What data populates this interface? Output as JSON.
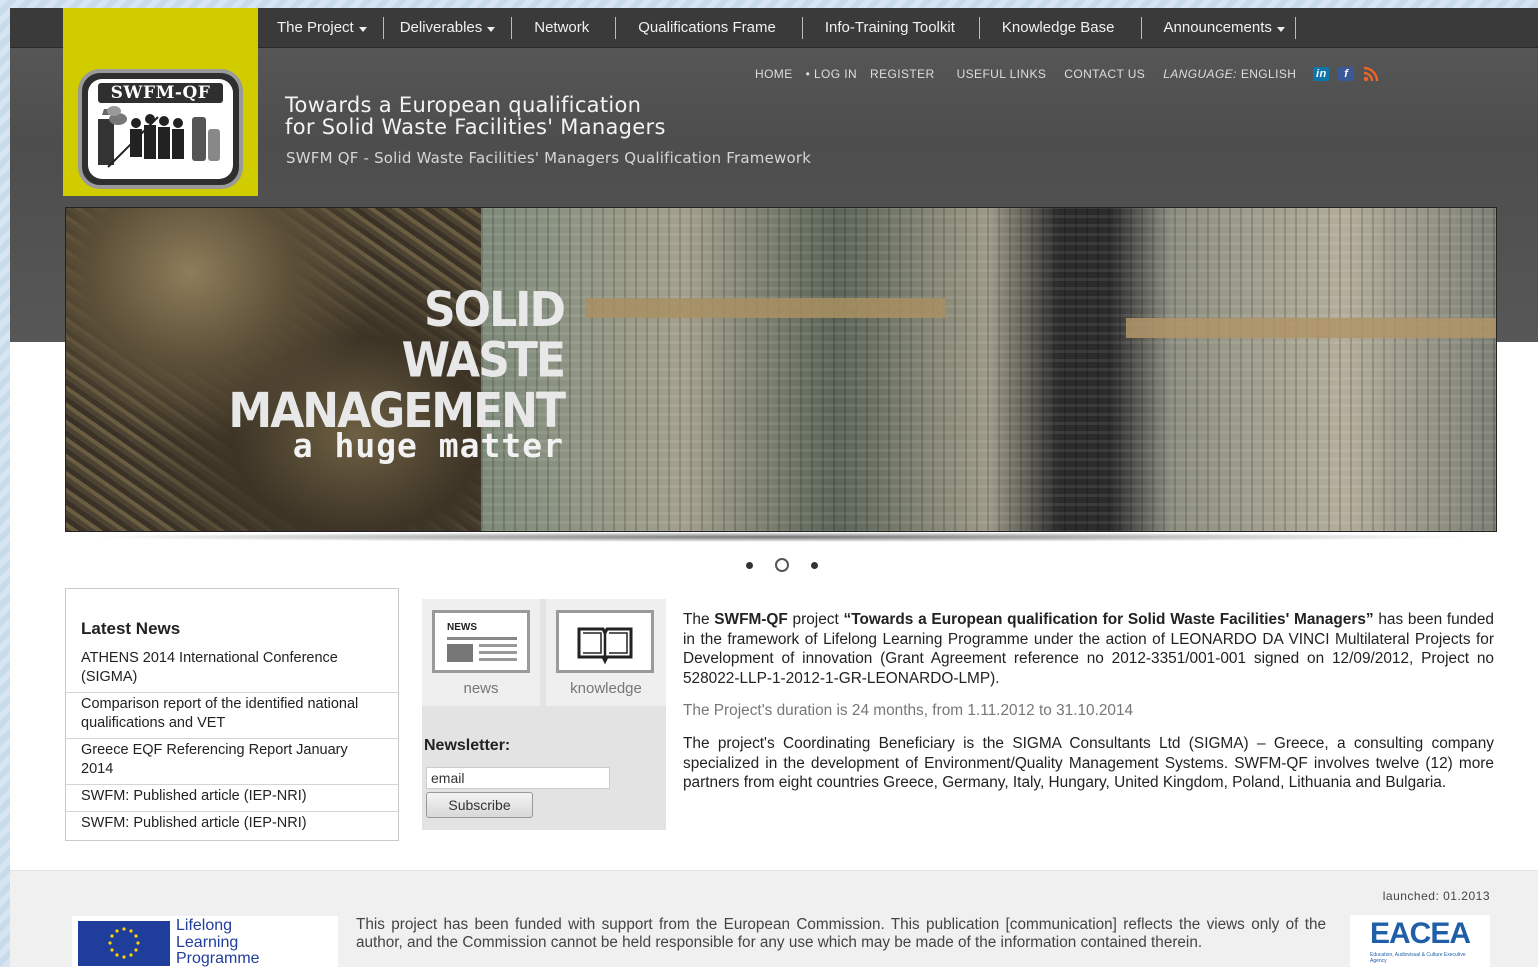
{
  "nav": {
    "items": [
      {
        "label": "The Project",
        "dropdown": true
      },
      {
        "label": "Deliverables",
        "dropdown": true
      },
      {
        "label": "Network",
        "dropdown": false
      },
      {
        "label": "Qualifications Frame",
        "dropdown": false
      },
      {
        "label": "Info-Training Toolkit",
        "dropdown": false
      },
      {
        "label": "Knowledge Base",
        "dropdown": false
      },
      {
        "label": "Announcements",
        "dropdown": true
      }
    ]
  },
  "logo": {
    "text": "SWFM-QF"
  },
  "util": {
    "home": "HOME",
    "login": "• LOG IN",
    "register": "REGISTER",
    "useful_links": "USEFUL LINKS",
    "contact": "CONTACT US",
    "language_key": "LANGUAGE:",
    "language_value": "ENGLISH",
    "social": [
      {
        "icon": "linkedin-icon",
        "glyph": "in",
        "color": "#0e76a8"
      },
      {
        "icon": "facebook-icon",
        "glyph": "f",
        "color": "#3b5998"
      },
      {
        "icon": "rss-icon",
        "glyph": "",
        "color": "#f26522"
      }
    ]
  },
  "header": {
    "tagline_line1": "Towards a European qualification",
    "tagline_line2": "for Solid Waste Facilities' Managers",
    "subtitle": "SWFM QF - Solid Waste Facilities' Managers Qualification Framework"
  },
  "hero": {
    "line1": "SOLID",
    "line2": "WASTE",
    "line3": "MANAGEMENT",
    "line4": "a huge matter",
    "slide_count": 3,
    "active_slide": 2
  },
  "news": {
    "title": "Latest News",
    "items": [
      "ATHENS 2014 International Conference (SIGMA)",
      "Comparison report of the identified national qualifications and VET",
      "Greece EQF Referencing Report January 2014",
      "SWFM: Published article (IEP-NRI)",
      "SWFM: Published article (IEP-NRI)"
    ]
  },
  "quick_links": {
    "news": {
      "label": "news",
      "badge": "NEWS"
    },
    "knowledge": {
      "label": "knowledge"
    }
  },
  "newsletter": {
    "title": "Newsletter:",
    "value": "email",
    "button": "Subscribe"
  },
  "about": {
    "p1_pre": "The ",
    "p1_bold1": "SWFM-QF",
    "p1_mid": " project ",
    "p1_bold2": "“Towards a European qualification for Solid Waste Facilities' Managers”",
    "p1_post": " has been funded in the framework of Lifelong Learning Programme under the action of LEONARDO DA VINCI Multilateral Projects for Development of innovation (Grant Agreement reference no 2012-3351/001-001 signed on 12/09/2012, Project no 528022-LLP-1-2012-1-GR-LEONARDO-LMP).",
    "p2": "The Project's duration is 24 months, from 1.11.2012 to 31.10.2014",
    "p3": "The project's Coordinating Beneficiary is the SIGMA Consultants Ltd (SIGMA) – Greece, a consulting company specialized in the development of Environment/Quality Management Systems. SWFM-QF involves twelve (12) more partners from eight countries Greece, Germany, Italy, Hungary, United Kingdom, Poland, Lithuania and Bulgaria."
  },
  "footer": {
    "launched": "launched: 01.2013",
    "llp_line1": "Lifelong",
    "llp_line2": "Learning",
    "llp_line3": "Programme",
    "disclaimer": "This project has been funded with support from the European Commission. This publication [communication] reflects the views only of the author, and the Commission cannot be held responsible for any use which may be made of the information contained therein.",
    "eacea": "EACEA",
    "eacea_sub": "Education, Audiovisual & Culture Executive Agency"
  },
  "colors": {
    "accent_yellow": "#d1cc00",
    "header_gray": "#555555",
    "nav_dark": "#3a3a3a",
    "eu_blue": "#1f3d9a"
  }
}
